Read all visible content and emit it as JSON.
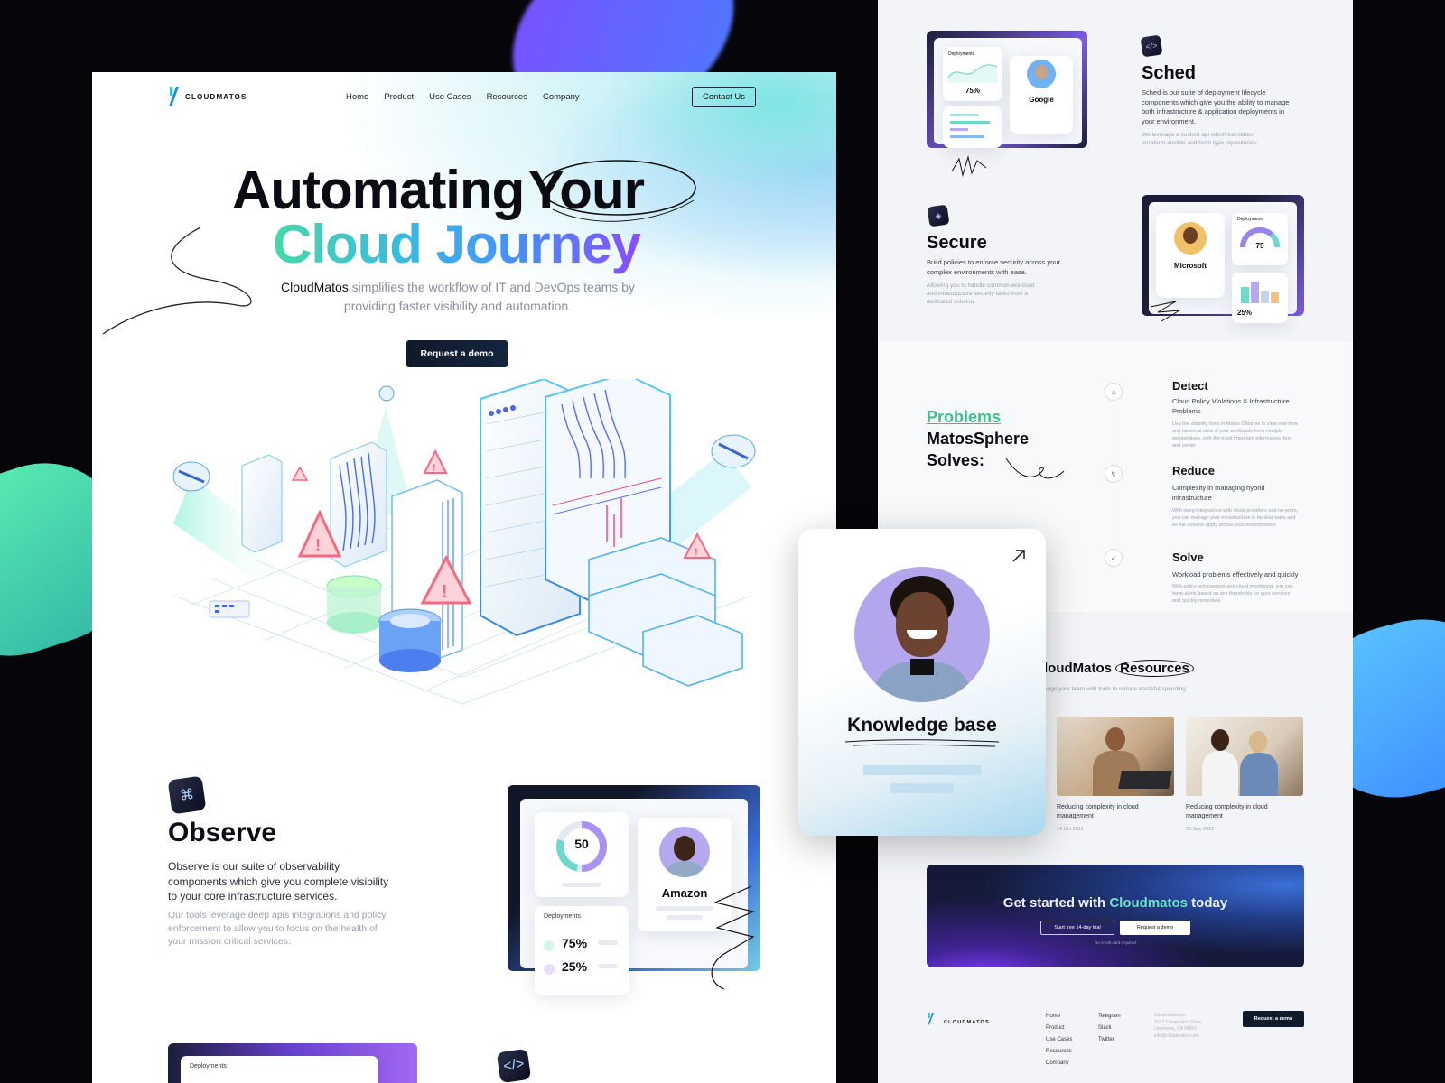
{
  "colors": {
    "accent_green": "#47d8a8",
    "accent_blue": "#4b88ff",
    "accent_purple": "#8a4dff",
    "dark": "#0f1a2b"
  },
  "brand": {
    "logo_text": "CLOUDMATOS"
  },
  "nav": {
    "items": [
      "Home",
      "Product",
      "Use Cases",
      "Resources",
      "Company"
    ],
    "contact": "Contact Us"
  },
  "hero": {
    "title_line1_a": "Automating",
    "title_line1_b": "Your",
    "title_line2": "Cloud Journey",
    "sub_brand": "CloudMatos",
    "sub_rest": " simplifies the workflow of IT and DevOps teams by providing faster visibility and automation.",
    "cta": "Request a demo"
  },
  "observe": {
    "title": "Observe",
    "desc": "Observe is our suite of observability components which give you complete visibility to your core infrastructure services.",
    "desc2": "Our tools leverage deep apis integrations and policy enforcement to allow you to focus on the health of your mission critical services.",
    "donut_value": "50",
    "company": "Amazon",
    "deploy_label": "Deployments",
    "stat1": "75%",
    "stat2": "25%"
  },
  "next_section": {
    "deploy_label": "Deployments"
  },
  "sched": {
    "title": "Sched",
    "desc": "Sched is our suite of deployment lifecycle components which give you the ability to manage both infrastructure & application deployments in your environment.",
    "desc2": "We leverage a custom api which translates terraform ansible and helm type repositories.",
    "deploy_label": "Deployments",
    "stat": "75%",
    "company": "Google"
  },
  "secure": {
    "title": "Secure",
    "desc": "Build policies to enforce security across your complex environments with ease.",
    "desc2": "Allowing you to handle common workload and infrastructure security tasks from a dedicated solution.",
    "company": "Microsoft",
    "deploy_label": "Deployments",
    "gauge_value": "75",
    "stat": "25%"
  },
  "problems": {
    "highlight": "Problems",
    "line2": "MatosSphere",
    "line3": "Solves:",
    "steps": [
      {
        "title": "Detect",
        "sub": "Cloud Policy Violations & Infrastructure Problems",
        "desc": "Use the visibility tools in Matos Observe to view real-time and historical data of your workloads from multiple perspectives, with the most important information front and center"
      },
      {
        "title": "Reduce",
        "sub": "Complexity in managing hybrid infrastructure",
        "desc": "With deep integrations with cloud providers and on-prem, you can manage your infrastructure in familiar ways and let the solution apply across your environments"
      },
      {
        "title": "Solve",
        "sub": "Workload problems effectively and quickly",
        "desc": "With policy enforcement and cloud monitoring, you can have alerts based on any thresholds for your services and quickly remediate"
      }
    ]
  },
  "resources": {
    "title_a": "loudMatos",
    "title_b": "Resources",
    "sub": "nage your team with tools to reduce wasteful spending",
    "posts": [
      {
        "title": "Reducing complexity in cloud management",
        "date": "14 Oct 2021"
      },
      {
        "title": "Reducing complexity in cloud management",
        "date": "25 Sep 2021"
      }
    ]
  },
  "knowledge": {
    "title": "Knowledge base"
  },
  "cta": {
    "title_a": "Get started with ",
    "title_b": "Cloudmatos",
    "title_c": " today",
    "btn1": "Start free 14-day trial",
    "btn2": "Request a demo",
    "note": "No credit card required"
  },
  "footer": {
    "col1": [
      "Home",
      "Product",
      "Use Cases",
      "Resources",
      "Company"
    ],
    "col2": [
      "Telegram",
      "Slack",
      "Twitter"
    ],
    "address": [
      "Cloudmatos Inc.",
      "3142 Constitution Drive,",
      "Livermore, CA 94551",
      "info@cloudmatos.com"
    ],
    "cta": "Request a demo"
  }
}
